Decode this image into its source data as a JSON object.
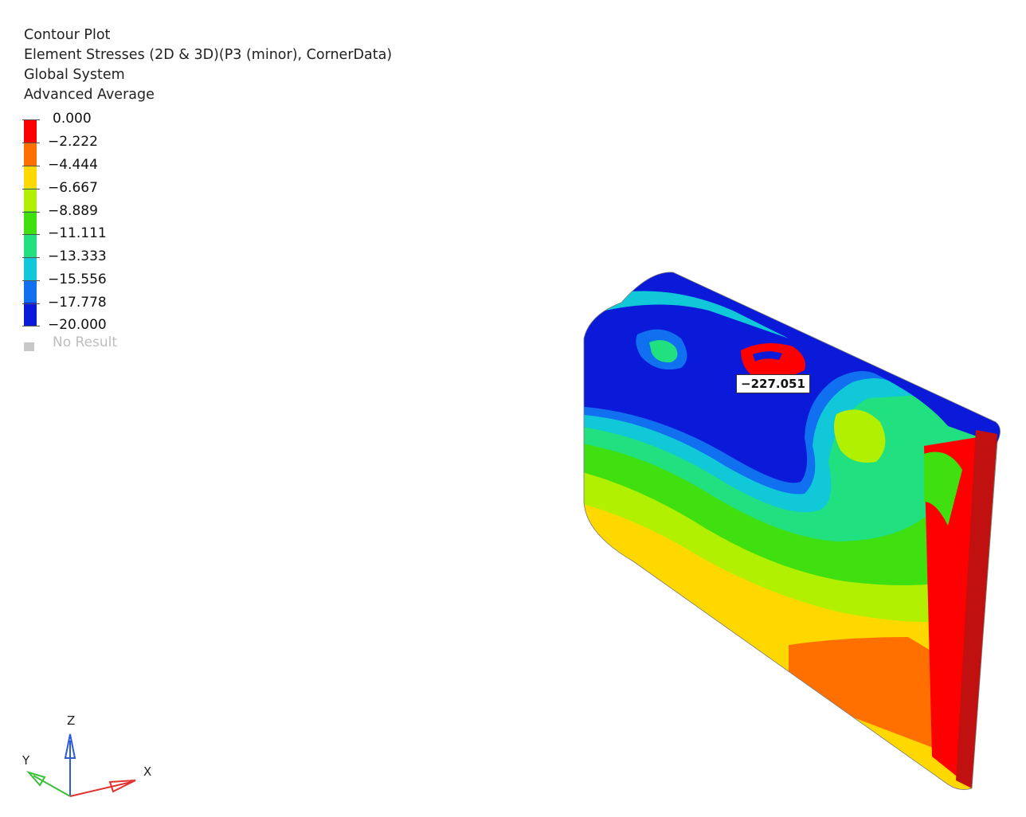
{
  "header": {
    "line1": "Contour Plot",
    "line2": "Element Stresses (2D & 3D)(P3 (minor), CornerData)",
    "line3": "Global System",
    "line4": "Advanced Average"
  },
  "legend": {
    "labels": [
      "0.000",
      "−2.222",
      "−4.444",
      "−6.667",
      "−8.889",
      "−11.111",
      "−13.333",
      "−15.556",
      "−17.778",
      "−20.000"
    ],
    "colors": [
      "#ff0000",
      "#ff7000",
      "#ffd800",
      "#b0f000",
      "#40e010",
      "#20e080",
      "#10c8d8",
      "#1070f0",
      "#0a1ad8"
    ],
    "no_result": "No Result"
  },
  "probe": {
    "value": "−227.051"
  },
  "triad": {
    "z": "Z",
    "y": "Y",
    "x": "X"
  }
}
